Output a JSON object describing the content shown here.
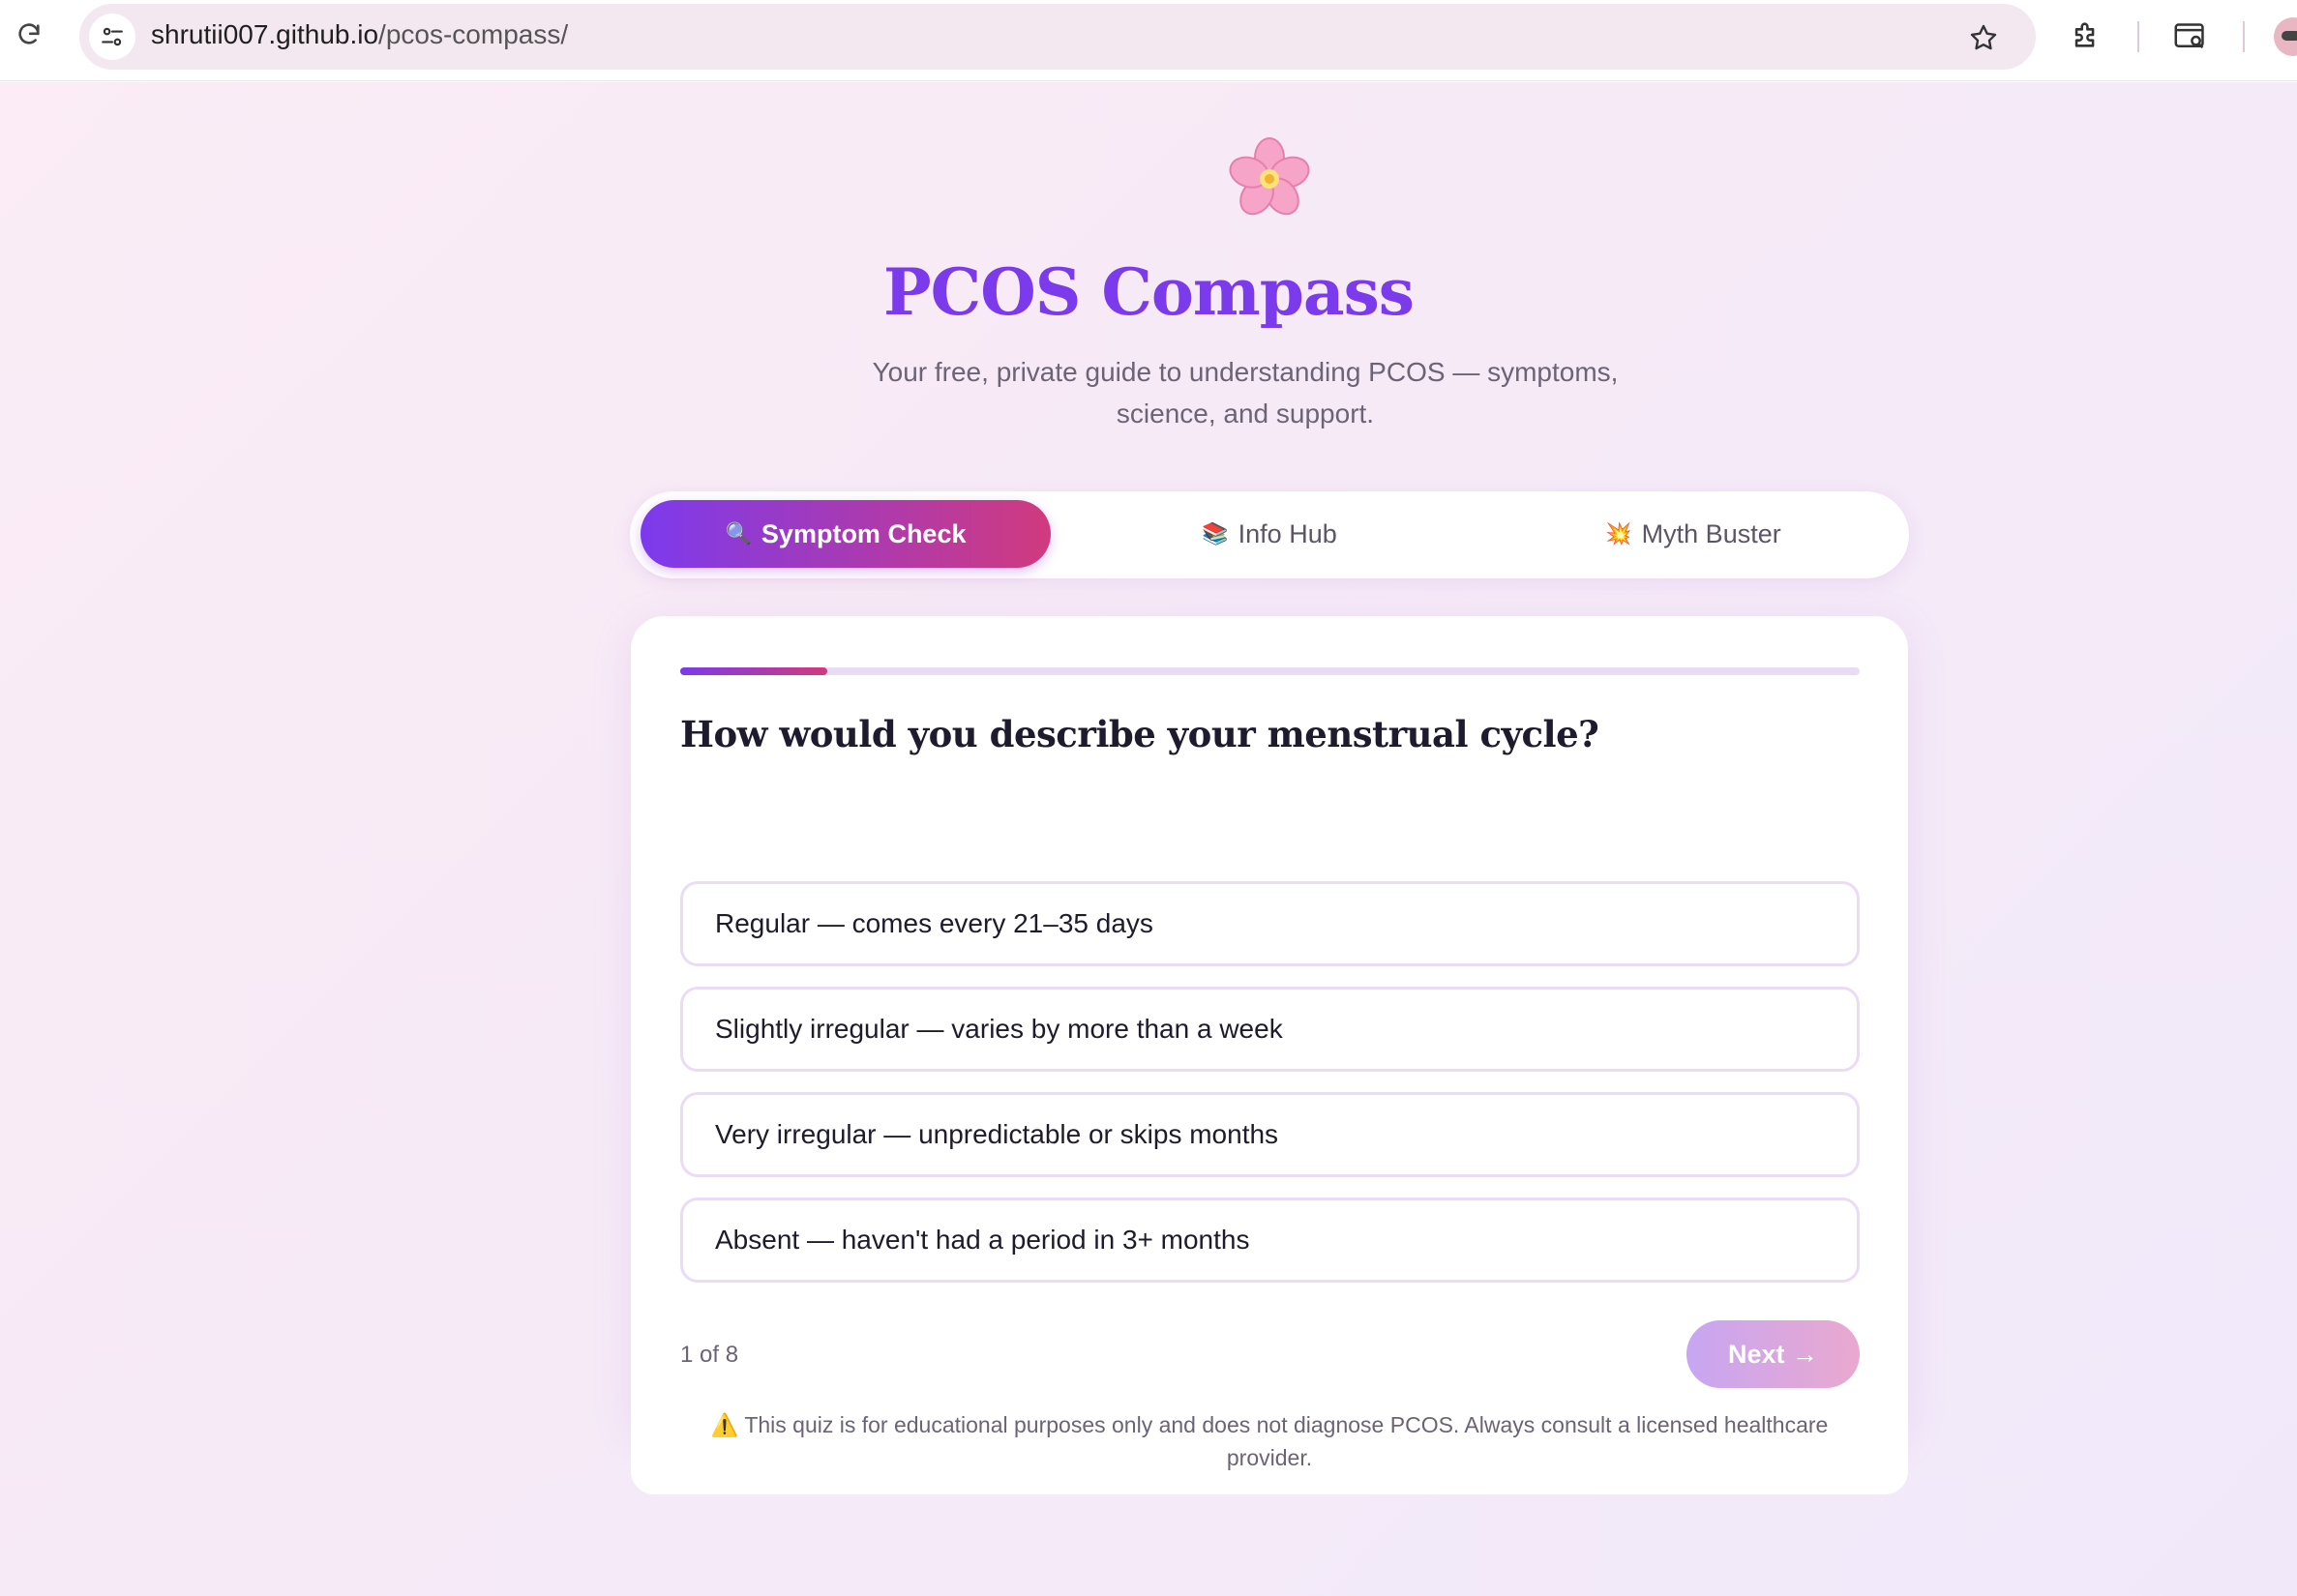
{
  "browser": {
    "url_host": "shrutii007.github.io",
    "url_path": "/pcos-compass/"
  },
  "header": {
    "logo_emoji": "🌸",
    "title": "PCOS Compass",
    "subtitle": "Your free, private guide to understanding PCOS — symptoms, science, and support."
  },
  "tabs": [
    {
      "emoji": "🔍",
      "label": "Symptom Check",
      "active": true
    },
    {
      "emoji": "📚",
      "label": "Info Hub",
      "active": false
    },
    {
      "emoji": "💥",
      "label": "Myth Buster",
      "active": false
    }
  ],
  "quiz": {
    "progress": 0.125,
    "question": "How would you describe your menstrual cycle?",
    "options": [
      "Regular — comes every 21–35 days",
      "Slightly irregular — varies by more than a week",
      "Very irregular — unpredictable or skips months",
      "Absent — haven't had a period in 3+ months"
    ],
    "counter": "1 of 8",
    "next_label": "Next →"
  },
  "disclaimer": {
    "icon": "⚠️",
    "text": "This quiz is for educational purposes only and does not diagnose PCOS. Always consult a licensed healthcare provider."
  },
  "colors": {
    "accent_purple": "#7c3aed",
    "accent_pink": "#d13a7e"
  }
}
